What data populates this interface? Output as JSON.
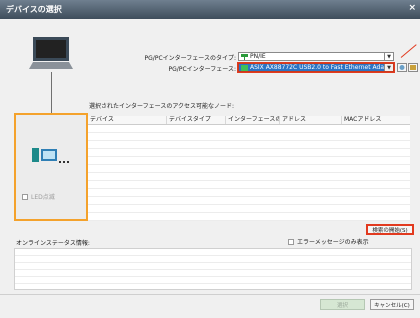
{
  "window": {
    "title": "デバイスの選択",
    "close": "×"
  },
  "interface": {
    "type_label": "PG/PCインターフェースのタイプ:",
    "type_value": "PN/IE",
    "iface_label": "PG/PCインターフェース:",
    "iface_value": "ASIX AX88772C USB2.0 to Fast Ethernet Ada..."
  },
  "nodes_label": "選択されたインターフェースのアクセス可能なノード:",
  "table": {
    "columns": [
      "デバイス",
      "デバイスタイプ",
      "インターフェースの...",
      "アドレス",
      "MACアドレス"
    ]
  },
  "led": "LED点滅",
  "search_button": "検索の開始(S)",
  "status_label": "オンラインステータス情報:",
  "errors_only": "エラーメッセージのみ表示",
  "buttons": {
    "select": "選択",
    "cancel": "キャンセル(C)"
  },
  "colors": {
    "highlight": "#e23a1f",
    "node_box": "#f4a22c",
    "selection": "#2c74c4"
  }
}
